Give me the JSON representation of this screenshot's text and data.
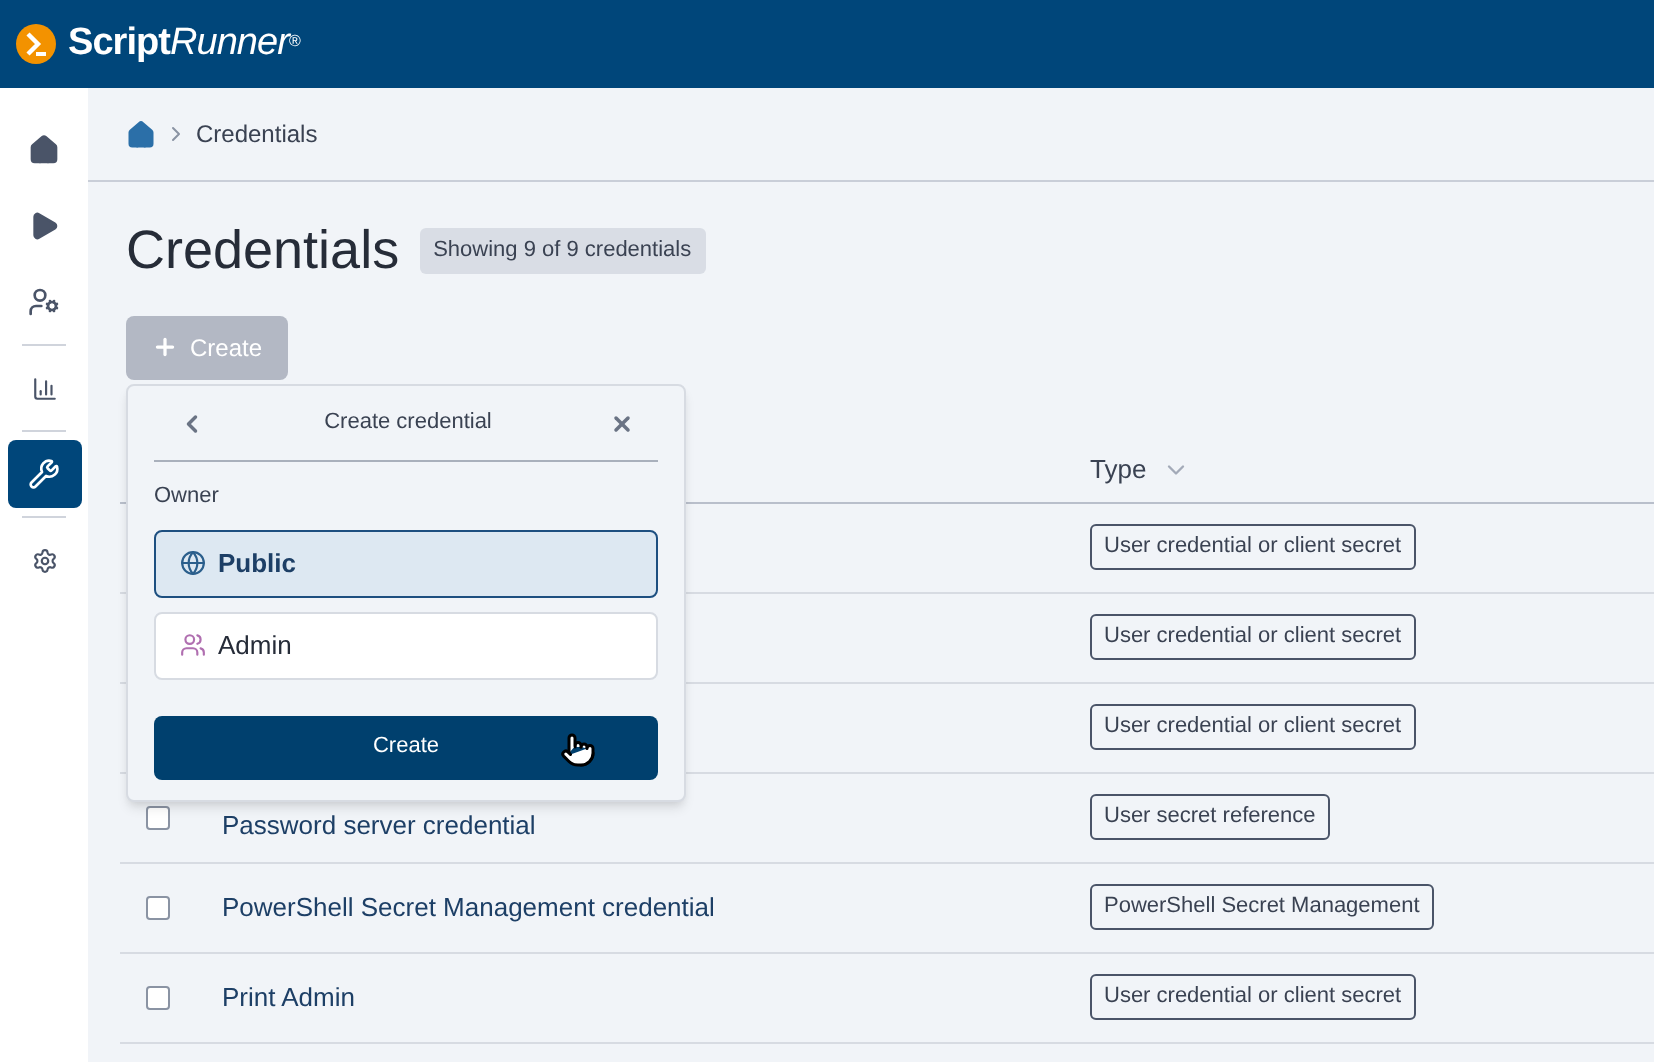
{
  "header": {
    "logo_bold": "Script",
    "logo_light": "Runner",
    "logo_mark": "®"
  },
  "sidebar": {
    "items": [
      {
        "kind": "home",
        "selected": false
      },
      {
        "kind": "play",
        "selected": false
      },
      {
        "kind": "user",
        "selected": false
      },
      {
        "kind": "chart",
        "selected": false
      },
      {
        "kind": "wrench",
        "selected": true
      },
      {
        "kind": "gear",
        "selected": false
      }
    ]
  },
  "breadcrumb": [
    "Credentials"
  ],
  "page": {
    "title": "Credentials",
    "count_badge": "Showing 9 of 9 credentials",
    "create_button": "Create"
  },
  "table": {
    "columns": [
      {
        "label": "Type"
      }
    ],
    "rows": [
      {
        "name": null,
        "type": "User credential or client secret"
      },
      {
        "name": null,
        "type": "User credential or client secret"
      },
      {
        "name": null,
        "type": "User credential or client secret"
      },
      {
        "name": "Password server credential",
        "checked": false,
        "type": "User secret reference"
      },
      {
        "name": "PowerShell Secret Management credential",
        "checked": false,
        "type": "PowerShell Secret Management"
      },
      {
        "name": "Print Admin",
        "checked": false,
        "type": "User credential or client secret"
      }
    ]
  },
  "popover": {
    "title": "Create credential",
    "section_label": "Owner",
    "options": [
      {
        "label": "Public",
        "kind": "globe",
        "selected": true
      },
      {
        "label": "Admin",
        "kind": "group",
        "selected": false
      }
    ],
    "submit": "Create"
  }
}
